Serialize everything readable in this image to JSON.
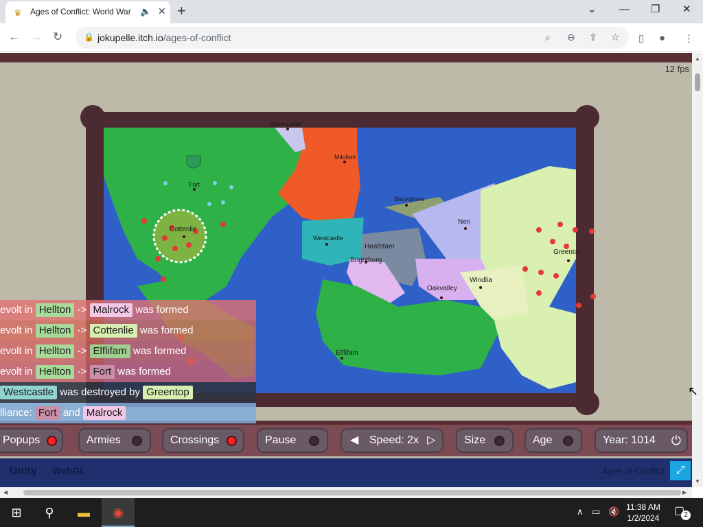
{
  "browser": {
    "tab_title": "Ages of Conflict: World War",
    "favicon": "crown-icon",
    "url_domain": "jokupelle.itch.io",
    "url_path": "/ages-of-conflict"
  },
  "game": {
    "fps": "12 fps",
    "cities": [
      {
        "name": "Yellowcreek"
      },
      {
        "name": "Milofork"
      },
      {
        "name": "Fort"
      },
      {
        "name": "Cottenlie"
      },
      {
        "name": "Blackgrave"
      },
      {
        "name": "Nen"
      },
      {
        "name": "Westcastle"
      },
      {
        "name": "Heathfam"
      },
      {
        "name": "Brightburg"
      },
      {
        "name": "Greenton"
      },
      {
        "name": "Windlia"
      },
      {
        "name": "Oakvalley"
      },
      {
        "name": "Elflifam"
      }
    ],
    "events": [
      {
        "prefix": "evolt in",
        "a": "Hellton",
        "arrow": "->",
        "b": "Malrock",
        "suffix": "was formed",
        "a_color": "#a9d99a",
        "b_color": "#f2c8e6",
        "row_color": "#e07070"
      },
      {
        "prefix": "evolt in",
        "a": "Hellton",
        "arrow": "->",
        "b": "Cottenlie",
        "suffix": "was formed",
        "a_color": "#a9d99a",
        "b_color": "#d6efb0",
        "row_color": "#d36a5c"
      },
      {
        "prefix": "evolt in",
        "a": "Hellton",
        "arrow": "->",
        "b": "Elflifam",
        "suffix": "was formed",
        "a_color": "#a9d99a",
        "b_color": "#9fcf8e",
        "row_color": "#cf6464"
      },
      {
        "prefix": "evolt in",
        "a": "Hellton",
        "arrow": "->",
        "b": "Fort",
        "suffix": "was formed",
        "a_color": "#a9d99a",
        "b_color": "#c98fa8",
        "row_color": "#c95f6d"
      },
      {
        "prefix": "",
        "a": "Westcastle",
        "arrow": "",
        "b": "Greentop",
        "suffix": "",
        "mid": "was destroyed by",
        "a_color": "#8fd4cf",
        "b_color": "#d6efb0",
        "row_color": "#2d3340"
      },
      {
        "prefix": "lliance:",
        "a": "Fort",
        "arrow": "",
        "b": "Malrock",
        "mid": "and",
        "suffix": "",
        "a_color": "#c98fa8",
        "b_color": "#f2c8e6",
        "row_color": "#7faee0"
      }
    ],
    "controls": {
      "popups": "Popups",
      "armies": "Armies",
      "crossings": "Crossings",
      "pause": "Pause",
      "speed": "Speed: 2x",
      "size": "Size",
      "age": "Age",
      "year": "Year: 1014"
    },
    "toggles": {
      "popups": true,
      "armies": false,
      "crossings": true,
      "pause": false,
      "size": false,
      "age": false
    },
    "footer": {
      "unity": "Unity",
      "webgl": "WebGL",
      "title": "Ages of Conflict"
    }
  },
  "taskbar": {
    "time": "11:38 AM",
    "date": "1/2/2024",
    "notifications": "2"
  }
}
